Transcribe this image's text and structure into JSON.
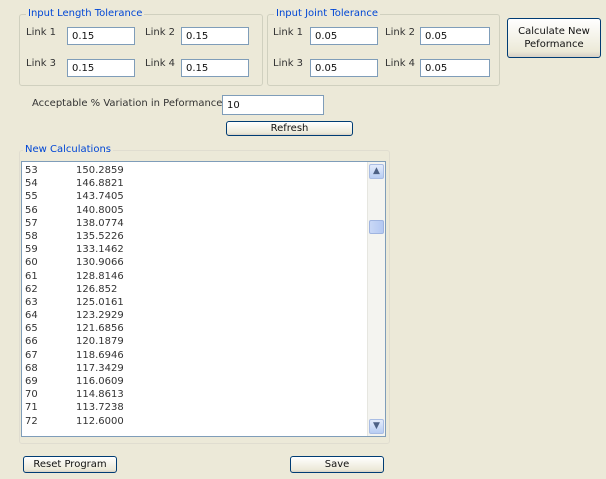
{
  "length_tolerance": {
    "title": "Input Length Tolerance",
    "link1_label": "Link 1",
    "link1_value": "0.15",
    "link2_label": "Link 2",
    "link2_value": "0.15",
    "link3_label": "Link 3",
    "link3_value": "0.15",
    "link4_label": "Link 4",
    "link4_value": "0.15"
  },
  "joint_tolerance": {
    "title": "Input Joint Tolerance",
    "link1_label": "Link 1",
    "link1_value": "0.05",
    "link2_label": "Link 2",
    "link2_value": "0.05",
    "link3_label": "Link 3",
    "link3_value": "0.05",
    "link4_label": "Link 4",
    "link4_value": "0.05"
  },
  "calculate_button": "Calculate New Peformance",
  "variation": {
    "label": "Acceptable % Variation in Peformance",
    "value": "10"
  },
  "refresh_button": "Refresh",
  "calculations": {
    "title": "New Calculations",
    "rows": [
      [
        "53",
        "150.2859"
      ],
      [
        "54",
        "146.8821"
      ],
      [
        "55",
        "143.7405"
      ],
      [
        "56",
        "140.8005"
      ],
      [
        "57",
        "138.0774"
      ],
      [
        "58",
        "135.5226"
      ],
      [
        "59",
        "133.1462"
      ],
      [
        "60",
        "130.9066"
      ],
      [
        "61",
        "128.8146"
      ],
      [
        "62",
        "126.852"
      ],
      [
        "63",
        "125.0161"
      ],
      [
        "64",
        "123.2929"
      ],
      [
        "65",
        "121.6856"
      ],
      [
        "66",
        "120.1879"
      ],
      [
        "67",
        "118.6946"
      ],
      [
        "68",
        "117.3429"
      ],
      [
        "69",
        "116.0609"
      ],
      [
        "70",
        "114.8613"
      ],
      [
        "71",
        "113.7238"
      ],
      [
        "72",
        "112.6000"
      ]
    ]
  },
  "reset_button": "Reset Program",
  "save_button": "Save",
  "scroll_up_icon": "▲",
  "scroll_down_icon": "▼"
}
